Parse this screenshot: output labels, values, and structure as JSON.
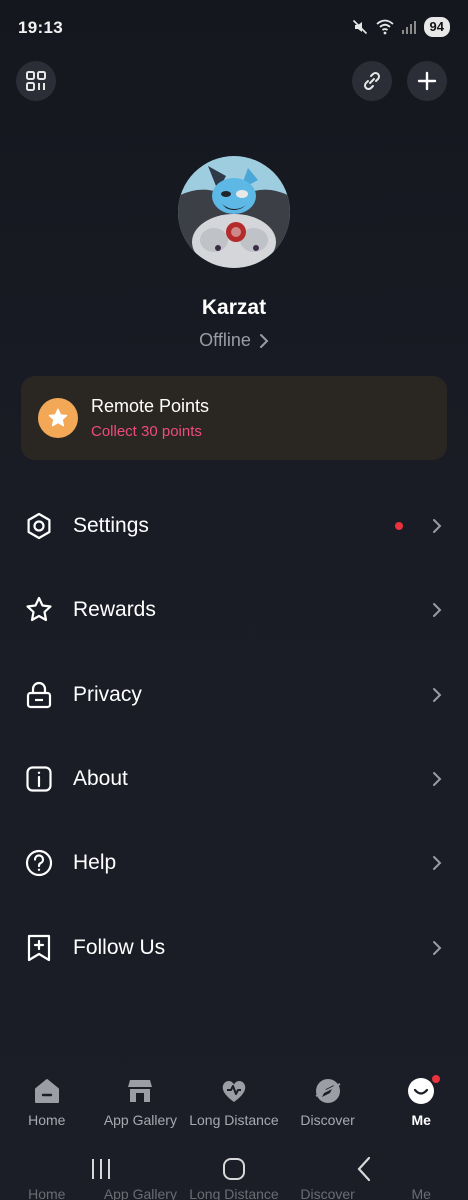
{
  "status_bar": {
    "time": "19:13",
    "battery": "94",
    "icons": [
      "mute-icon",
      "wifi-icon",
      "signal-icon",
      "battery-icon"
    ]
  },
  "header": {
    "left_icon": "qr-code-icon",
    "right_icons": [
      "link-icon",
      "plus-icon"
    ]
  },
  "profile": {
    "name": "Karzat",
    "status": "Offline"
  },
  "points": {
    "title": "Remote Points",
    "subtitle": "Collect 30 points",
    "accent": "#f3a857",
    "subtitle_color": "#ef4b7e"
  },
  "menu": [
    {
      "label": "Settings",
      "icon": "gear-icon",
      "badge": true
    },
    {
      "label": "Rewards",
      "icon": "star-outline-icon",
      "badge": false
    },
    {
      "label": "Privacy",
      "icon": "lock-icon",
      "badge": false
    },
    {
      "label": "About",
      "icon": "info-icon",
      "badge": false
    },
    {
      "label": "Help",
      "icon": "question-icon",
      "badge": false
    },
    {
      "label": "Follow Us",
      "icon": "bookmark-plus-icon",
      "badge": false
    }
  ],
  "tabs": [
    {
      "label": "Home",
      "icon": "home-icon",
      "active": false
    },
    {
      "label": "App Gallery",
      "icon": "store-icon",
      "active": false
    },
    {
      "label": "Long Distance",
      "icon": "heart-icon",
      "active": false
    },
    {
      "label": "Discover",
      "icon": "compass-icon",
      "active": false
    },
    {
      "label": "Me",
      "icon": "smiley-icon",
      "active": true
    }
  ],
  "ghost_tabs": [
    "Home",
    "App Gallery",
    "Long Distance",
    "Discover",
    "Me"
  ]
}
